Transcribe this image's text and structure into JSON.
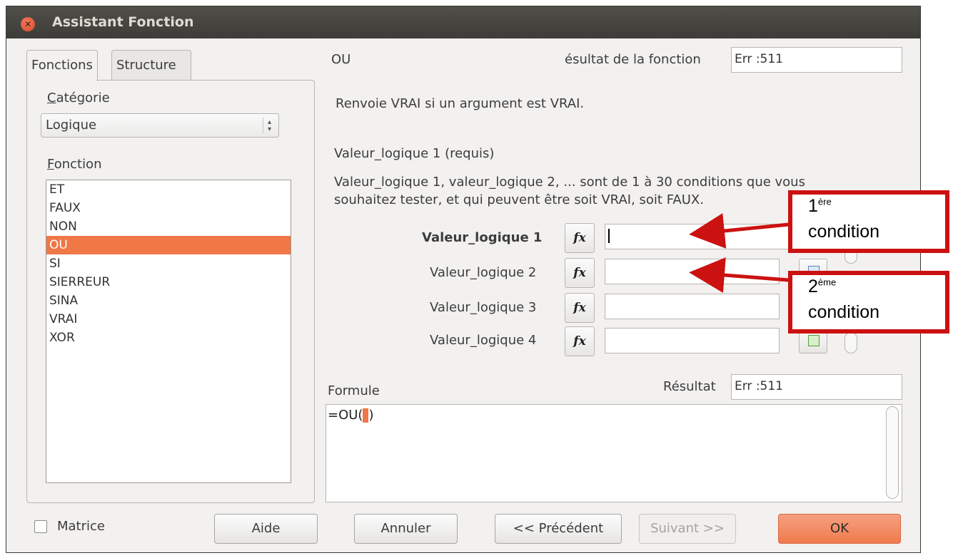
{
  "window": {
    "title": "Assistant Fonction"
  },
  "tabs": [
    "Fonctions",
    "Structure"
  ],
  "category": {
    "label": "Catégorie",
    "selected": "Logique"
  },
  "function_list": {
    "label": "Fonction",
    "items": [
      "ET",
      "FAUX",
      "NON",
      "OU",
      "SI",
      "SIERREUR",
      "SINA",
      "VRAI",
      "XOR"
    ],
    "selected": "OU"
  },
  "function_info": {
    "name": "OU",
    "result_label": "ésultat de la fonction",
    "result_value": "Err :511",
    "description": "Renvoie VRAI si un argument est VRAI.",
    "arg_title": "Valeur_logique 1 (requis)",
    "arg_desc_line1": "Valeur_logique 1, valeur_logique 2, ... sont de 1 à 30 conditions que vous",
    "arg_desc_line2": "souhaitez tester, et qui peuvent être soit VRAI, soit FAUX."
  },
  "arguments": [
    {
      "label": "Valeur_logique 1",
      "value": ""
    },
    {
      "label": "Valeur_logique 2",
      "value": ""
    },
    {
      "label": "Valeur_logique 3",
      "value": ""
    },
    {
      "label": "Valeur_logique 4",
      "value": ""
    }
  ],
  "fx_symbol": "fx",
  "formula": {
    "label": "Formule",
    "value": "=OU(",
    "closing": ")",
    "result_label": "Résultat",
    "result_value": "Err :511"
  },
  "matrix_label": "Matrice",
  "buttons": {
    "help": "Aide",
    "cancel": "Annuler",
    "previous": "<< Précédent",
    "next": "Suivant >>",
    "ok": "OK"
  },
  "callouts": [
    {
      "number": "1",
      "suffix": "ère",
      "word": "condition"
    },
    {
      "number": "2",
      "suffix": "ème",
      "word": "condition"
    }
  ],
  "colors": {
    "accent": "#f07746",
    "callout": "#cc1111",
    "titlebar": "#3d3c38"
  }
}
